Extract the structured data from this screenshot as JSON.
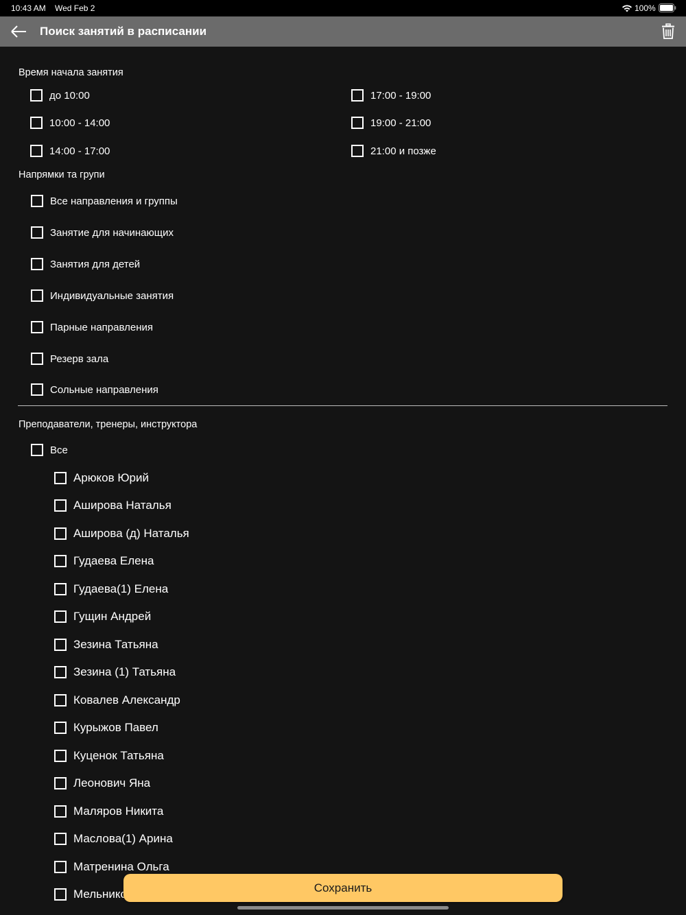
{
  "status_bar": {
    "time": "10:43 AM",
    "date": "Wed Feb 2",
    "battery": "100%"
  },
  "header": {
    "title": "Поиск занятий в расписании",
    "back_icon": "arrow-left-icon",
    "trash_icon": "trash-icon"
  },
  "time_section": {
    "label": "Время начала занятия",
    "options": [
      {
        "label": "до 10:00",
        "checked": false
      },
      {
        "label": "10:00 - 14:00",
        "checked": false
      },
      {
        "label": "14:00 - 17:00",
        "checked": false
      },
      {
        "label": "17:00 - 19:00",
        "checked": false
      },
      {
        "label": "19:00 - 21:00",
        "checked": false
      },
      {
        "label": "21:00 и позже",
        "checked": false
      }
    ]
  },
  "directions_section": {
    "label": "Напрямки та групи",
    "options": [
      {
        "label": "Все направления и группы",
        "checked": false
      },
      {
        "label": "Занятие для начинающих",
        "checked": false
      },
      {
        "label": "Занятия для детей",
        "checked": false
      },
      {
        "label": "Индивидуальные занятия",
        "checked": false
      },
      {
        "label": "Парные направления",
        "checked": false
      },
      {
        "label": "Резерв зала",
        "checked": false
      },
      {
        "label": "Сольные направления",
        "checked": false
      }
    ]
  },
  "teachers_section": {
    "label": "Преподаватели, тренеры, инструктора",
    "all_label": "Все",
    "teachers": [
      "Арюков Юрий",
      "Аширова Наталья",
      "Аширова (д) Наталья",
      "Гудаева Елена",
      "Гудаева(1) Елена",
      "Гущин Андрей",
      "Зезина Татьяна",
      "Зезина (1) Татьяна",
      "Ковалев Александр",
      "Курыжов Павел",
      "Куценок Татьяна",
      "Леонович Яна",
      "Маляров Никита",
      "Маслова(1) Арина",
      "Матренина Ольга",
      "Мельнико"
    ]
  },
  "save_button": {
    "label": "Сохранить",
    "color": "#ffc864"
  }
}
